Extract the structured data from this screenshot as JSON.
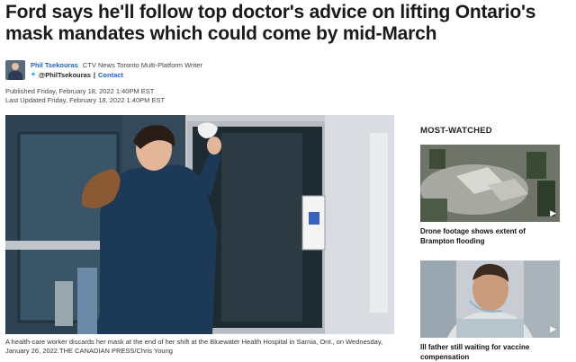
{
  "article": {
    "headline": "Ford says he'll follow top doctor's advice on lifting Ontario's mask mandates which could come by mid-March",
    "author_name": "Phil Tsekouras",
    "author_role": "CTV News Toronto Multi-Platform Writer",
    "author_handle": "@PhilTsekouras",
    "separator": "|",
    "contact_label": "Contact",
    "published": "Published Friday, February 18, 2022 1:40PM EST",
    "updated": "Last Updated Friday, February 18, 2022 1:40PM EST",
    "caption": "A health-care worker discards her mask at the end of her shift at the Bluewater Health Hospital in Sarnia, Ont., on Wednesday, January 26, 2022.THE CANADIAN PRESS/Chris Young"
  },
  "sidebar": {
    "title": "MOST-WATCHED",
    "items": [
      {
        "title": "Drone footage shows extent of Brampton flooding",
        "icon": "play-icon"
      },
      {
        "title": "Ill father still waiting for vaccine compensation",
        "icon": "play-icon"
      }
    ]
  },
  "icons": {
    "twitter": "twitter-icon",
    "play": "play-icon"
  },
  "colors": {
    "link": "#1c64c4",
    "twitter": "#1da1f2",
    "text": "#1a1a1a"
  }
}
